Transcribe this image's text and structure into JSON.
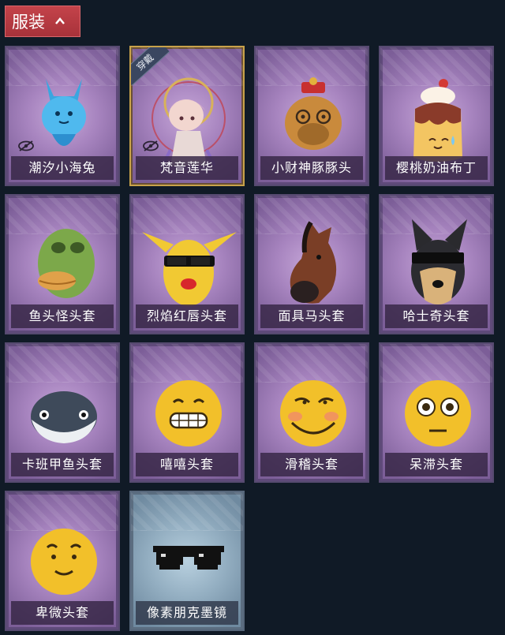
{
  "category_tab": {
    "label": "服装"
  },
  "equipped_badge": "穿戴",
  "items": [
    {
      "name": "潮汐小海兔",
      "hidden": true
    },
    {
      "name": "梵音莲华",
      "hidden": true,
      "equipped": true
    },
    {
      "name": "小财神豚豚头"
    },
    {
      "name": "樱桃奶油布丁"
    },
    {
      "name": "鱼头怪头套"
    },
    {
      "name": "烈焰红唇头套"
    },
    {
      "name": "面具马头套"
    },
    {
      "name": "哈士奇头套"
    },
    {
      "name": "卡班甲鱼头套"
    },
    {
      "name": "嘻嘻头套"
    },
    {
      "name": "滑稽头套"
    },
    {
      "name": "呆滞头套"
    },
    {
      "name": "卑微头套"
    },
    {
      "name": "像素朋克墨镜"
    }
  ]
}
